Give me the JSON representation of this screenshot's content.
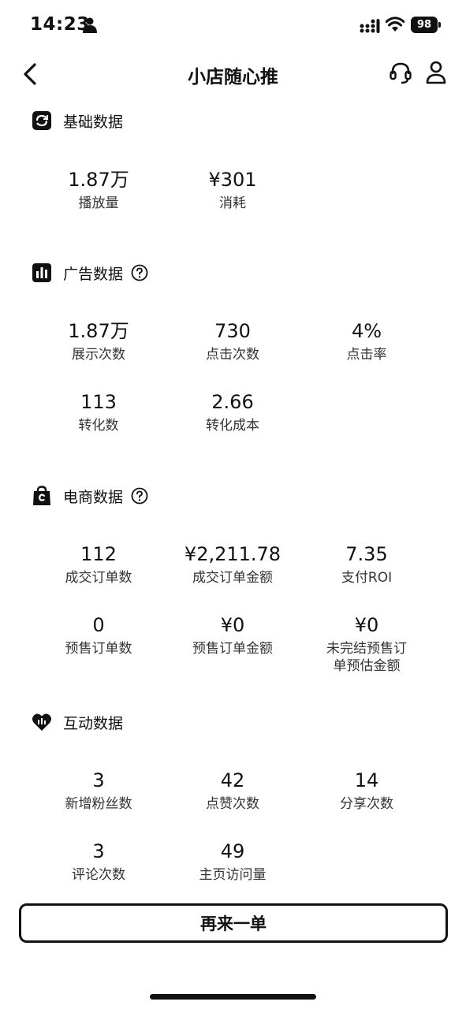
{
  "status_bar": {
    "time": "14:23",
    "battery": "98"
  },
  "header": {
    "title": "小店随心推"
  },
  "sections": {
    "basic": {
      "title": "基础数据",
      "stats": [
        {
          "value": "1.87万",
          "label": "播放量"
        },
        {
          "value": "¥301",
          "label": "消耗"
        }
      ]
    },
    "ads": {
      "title": "广告数据",
      "stats": [
        {
          "value": "1.87万",
          "label": "展示次数"
        },
        {
          "value": "730",
          "label": "点击次数"
        },
        {
          "value": "4%",
          "label": "点击率"
        },
        {
          "value": "113",
          "label": "转化数"
        },
        {
          "value": "2.66",
          "label": "转化成本"
        }
      ]
    },
    "ecommerce": {
      "title": "电商数据",
      "stats": [
        {
          "value": "112",
          "label": "成交订单数"
        },
        {
          "value": "¥2,211.78",
          "label": "成交订单金额"
        },
        {
          "value": "7.35",
          "label": "支付ROI"
        },
        {
          "value": "0",
          "label": "预售订单数"
        },
        {
          "value": "¥0",
          "label": "预售订单金额"
        },
        {
          "value": "¥0",
          "label": "未完结预售订\n单预估金额"
        }
      ]
    },
    "interaction": {
      "title": "互动数据",
      "stats": [
        {
          "value": "3",
          "label": "新增粉丝数"
        },
        {
          "value": "42",
          "label": "点赞次数"
        },
        {
          "value": "14",
          "label": "分享次数"
        },
        {
          "value": "3",
          "label": "评论次数"
        },
        {
          "value": "49",
          "label": "主页访问量"
        }
      ]
    }
  },
  "footer": {
    "button_label": "再来一单"
  },
  "icons": {
    "back": "chevron-left-icon",
    "service": "headset-icon",
    "profile": "person-icon",
    "basic": "refresh-chart-icon",
    "ads": "bar-chart-icon",
    "ecommerce": "shopping-bag-icon",
    "interaction": "heart-icon",
    "help": "question-circle-icon"
  }
}
